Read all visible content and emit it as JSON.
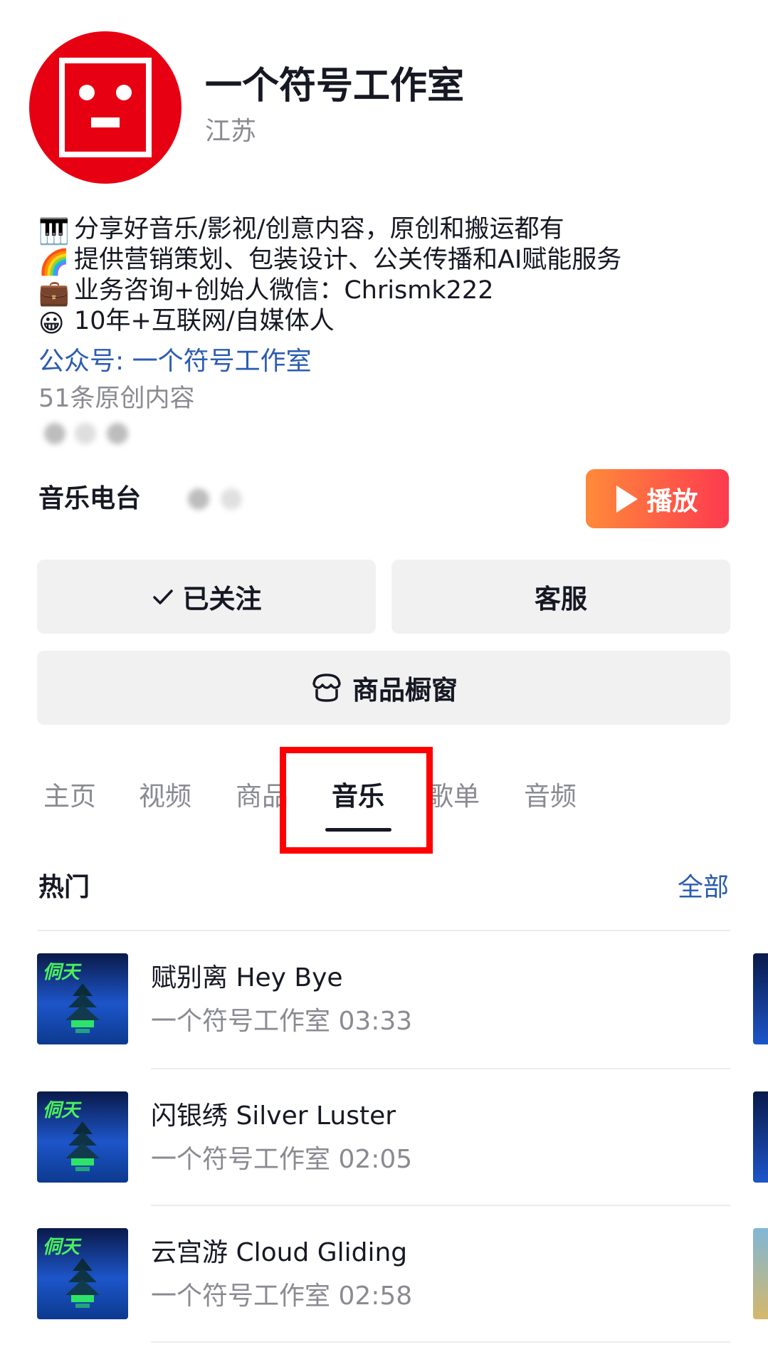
{
  "profile": {
    "name": "一个符号工作室",
    "region": "江苏",
    "avatar_color": "#e60012"
  },
  "bio": [
    {
      "icon": "piano-emoji",
      "glyph": "🎹",
      "text": "分享好音乐/影视/创意内容，原创和搬运都有"
    },
    {
      "icon": "rainbow-emoji",
      "glyph": "🌈",
      "text": "提供营销策划、包装设计、公关传播和AI赋能服务"
    },
    {
      "icon": "briefcase-emoji",
      "glyph": "💼",
      "text": "业务咨询+创始人微信：Chrismk222"
    },
    {
      "icon": "grinning-face-emoji",
      "glyph": "😀",
      "text": "10年+互联网/自媒体人"
    }
  ],
  "official_account": "公众号: 一个符号工作室",
  "original_count": "51条原创内容",
  "radio": {
    "label": "音乐电台",
    "play_label": "播放"
  },
  "actions": {
    "follow_label": "已关注",
    "service_label": "客服",
    "shop_label": "商品橱窗"
  },
  "tabs": [
    {
      "label": "主页",
      "active": false
    },
    {
      "label": "视频",
      "active": false
    },
    {
      "label": "商品",
      "active": false
    },
    {
      "label": "音乐",
      "active": true
    },
    {
      "label": "歌单",
      "active": false
    },
    {
      "label": "音频",
      "active": false
    }
  ],
  "section": {
    "title": "热门",
    "all_label": "全部"
  },
  "songs": [
    {
      "title": "赋别离  Hey Bye",
      "artist": "一个符号工作室",
      "duration": "03:33",
      "cover_text": "侗天"
    },
    {
      "title": "闪银绣  Silver Luster",
      "artist": "一个符号工作室",
      "duration": "02:05",
      "cover_text": "侗天"
    },
    {
      "title": "云宫游  Cloud Gliding",
      "artist": "一个符号工作室",
      "duration": "02:58",
      "cover_text": "侗天"
    }
  ],
  "colors": {
    "accent_link": "#2b5cb1",
    "play_gradient_start": "#ff8a3a",
    "play_gradient_end": "#fd3a4f",
    "highlight_box": "#ff0000"
  }
}
